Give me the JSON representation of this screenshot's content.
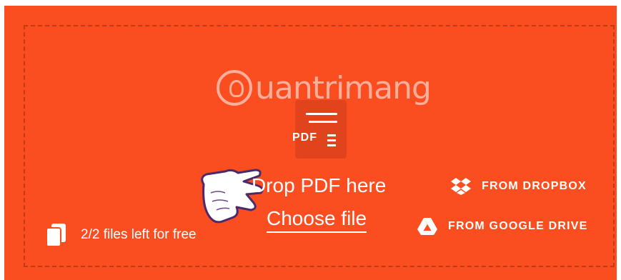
{
  "watermark": {
    "brand": "uantrimang"
  },
  "pdf_icon": {
    "label": "PDF"
  },
  "dropzone": {
    "title": "Drop PDF here",
    "choose_file": "Choose file"
  },
  "sources": {
    "dropbox": "FROM DROPBOX",
    "google_drive": "FROM GOOGLE DRIVE"
  },
  "quota": {
    "text": "2/2 files left for free"
  },
  "colors": {
    "background": "#fa4e21",
    "text": "#ffffff"
  },
  "icons": [
    "file-copies-icon",
    "pdf-document-icon",
    "dropbox-icon",
    "google-drive-icon",
    "hand-pointer-icon",
    "watermark-logo-icon"
  ]
}
